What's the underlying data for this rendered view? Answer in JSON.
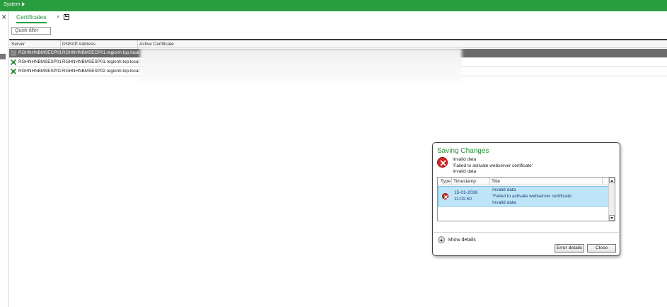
{
  "topbar": {
    "menu_label": "System",
    "color": "#2a9d3f"
  },
  "sidebar": {
    "close_glyph": "✕"
  },
  "tabs": [
    {
      "label": "Certificates",
      "close_glyph": "×",
      "active": true
    }
  ],
  "filter": {
    "placeholder": "Quick filter"
  },
  "table": {
    "columns": [
      "Server",
      "DNS/IP Address",
      "Active Certificate"
    ],
    "rows": [
      {
        "server": "RGHNHNBMSECP01",
        "dns": "RGHNHNBMSECP01.regionh.top.local",
        "icon": "server-dim-icon",
        "selected": true
      },
      {
        "server": "RGHNHNBMSESP01",
        "dns": "RGHNHNBMSESP01.regionh.top.local",
        "icon": "server-cross-icon",
        "selected": false
      },
      {
        "server": "RGHNHNBMSESP02",
        "dns": "RGHNHNBMSESP02.regionh.top.local",
        "icon": "server-cross-icon",
        "selected": false
      }
    ]
  },
  "dialog": {
    "title": "Saving Changes",
    "icon": "error-icon",
    "message_lines": [
      "Invalid data",
      "'Failed to activate webserver certificate'",
      "Invalid data"
    ],
    "grid": {
      "columns": [
        "Type",
        "Timestamp",
        "Title"
      ],
      "rows": [
        {
          "type_icon": "error-icon",
          "date": "15-01-2026",
          "time": "11:01:50",
          "title_lines": [
            "Invalid data",
            "'Failed to activate webserver certificate'",
            "Invalid data"
          ]
        }
      ]
    },
    "show_details_label": "Show details",
    "error_details_label": "Error details",
    "close_label": "Close",
    "title_color": "#2a8c3c",
    "error_color": "#d42525",
    "selection_color": "#bfe4f7"
  }
}
